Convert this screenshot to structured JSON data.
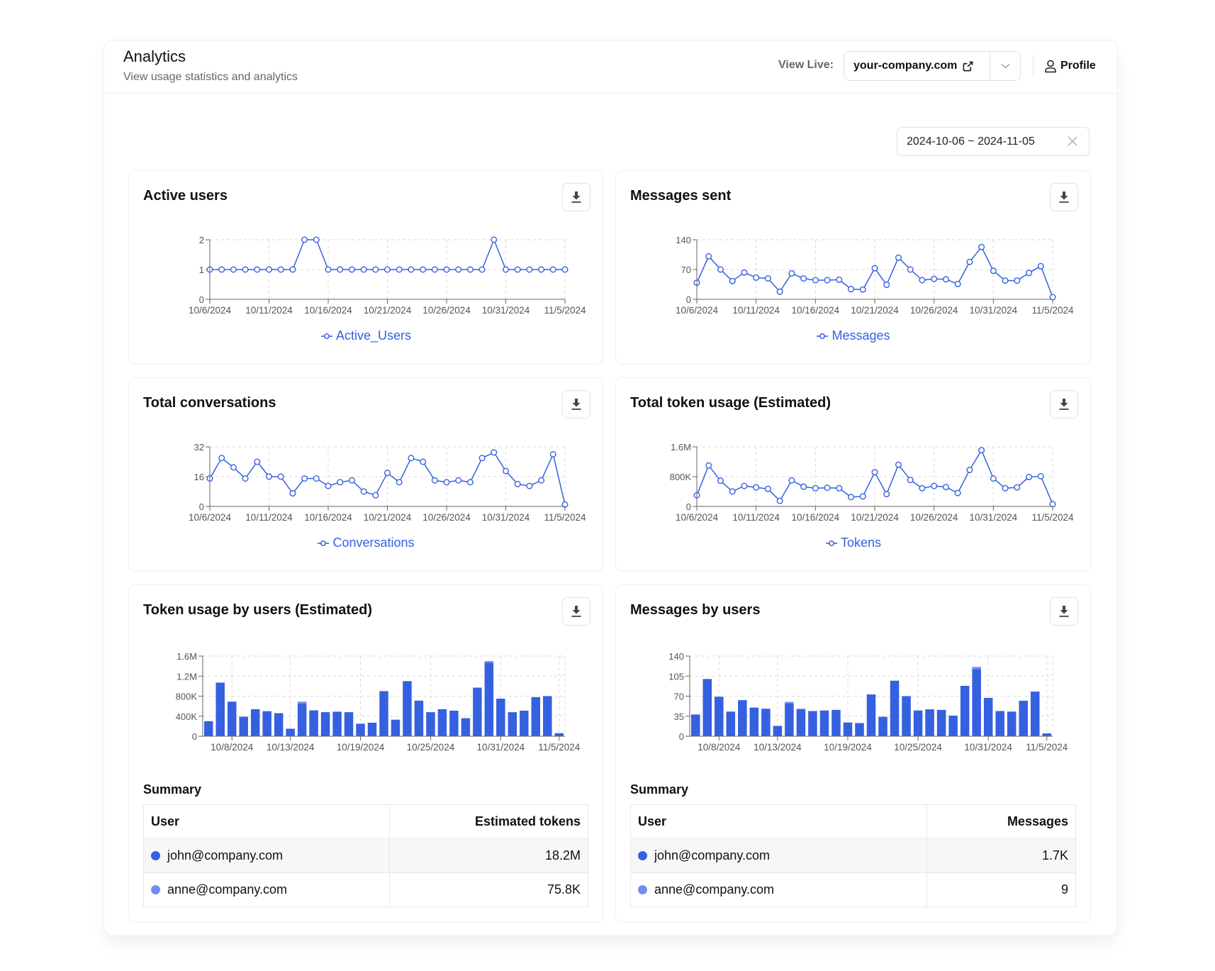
{
  "header": {
    "title": "Analytics",
    "subtitle": "View usage statistics and analytics",
    "view_live_label": "View Live:",
    "site": "your-company.com",
    "profile_label": "Profile"
  },
  "date_range": {
    "value": "2024-10-06 ~ 2024-11-05"
  },
  "colors": {
    "primary": "#3560e0",
    "secondary": "#6d8ff0",
    "grid": "#d9d9d9",
    "axis": "#666666"
  },
  "panels": {
    "active_users": {
      "title": "Active users",
      "legend": "Active_Users"
    },
    "messages_sent": {
      "title": "Messages sent",
      "legend": "Messages"
    },
    "total_conversations": {
      "title": "Total conversations",
      "legend": "Conversations"
    },
    "token_usage": {
      "title": "Total token usage (Estimated)",
      "legend": "Tokens"
    },
    "token_by_users": {
      "title": "Token usage by users (Estimated)",
      "summary_title": "Summary",
      "col_user": "User",
      "col_value": "Estimated tokens",
      "rows": [
        {
          "user": "john@company.com",
          "value": "18.2M",
          "color": "#3560e0"
        },
        {
          "user": "anne@company.com",
          "value": "75.8K",
          "color": "#6d8ff0"
        }
      ]
    },
    "messages_by_users": {
      "title": "Messages by users",
      "summary_title": "Summary",
      "col_user": "User",
      "col_value": "Messages",
      "rows": [
        {
          "user": "john@company.com",
          "value": "1.7K",
          "color": "#3560e0"
        },
        {
          "user": "anne@company.com",
          "value": "9",
          "color": "#6d8ff0"
        }
      ]
    }
  },
  "chart_data": [
    {
      "id": "active_users",
      "type": "line",
      "title": "Active users",
      "x_start": "2024-10-06",
      "x_ticks": [
        "10/6/2024",
        "10/11/2024",
        "10/16/2024",
        "10/21/2024",
        "10/26/2024",
        "10/31/2024",
        "11/5/2024"
      ],
      "y_ticks": [
        0,
        1,
        2
      ],
      "ylim": [
        0,
        2
      ],
      "legend": "Active_Users",
      "legend_position": "bottom",
      "grid": true,
      "values": [
        1,
        1,
        1,
        1,
        1,
        1,
        1,
        1,
        2,
        2,
        1,
        1,
        1,
        1,
        1,
        1,
        1,
        1,
        1,
        1,
        1,
        1,
        1,
        1,
        2,
        1,
        1,
        1,
        1,
        1,
        1
      ]
    },
    {
      "id": "messages_sent",
      "type": "line",
      "title": "Messages sent",
      "x_start": "2024-10-06",
      "x_ticks": [
        "10/6/2024",
        "10/11/2024",
        "10/16/2024",
        "10/21/2024",
        "10/26/2024",
        "10/31/2024",
        "11/5/2024"
      ],
      "y_ticks": [
        0,
        70,
        140
      ],
      "ylim": [
        0,
        140
      ],
      "legend": "Messages",
      "legend_position": "bottom",
      "grid": true,
      "values": [
        39,
        101,
        70,
        43,
        63,
        51,
        49,
        18,
        61,
        49,
        45,
        45,
        46,
        24,
        23,
        73,
        34,
        98,
        70,
        45,
        48,
        47,
        36,
        88,
        123,
        67,
        44,
        44,
        62,
        78,
        5
      ]
    },
    {
      "id": "total_conversations",
      "type": "line",
      "title": "Total conversations",
      "x_start": "2024-10-06",
      "x_ticks": [
        "10/6/2024",
        "10/11/2024",
        "10/16/2024",
        "10/21/2024",
        "10/26/2024",
        "10/31/2024",
        "11/5/2024"
      ],
      "y_ticks": [
        0,
        16,
        32
      ],
      "ylim": [
        0,
        32
      ],
      "legend": "Conversations",
      "legend_position": "bottom",
      "grid": true,
      "values": [
        15,
        26,
        21,
        15,
        24,
        16,
        16,
        7,
        15,
        15,
        11,
        13,
        14,
        8,
        6,
        18,
        13,
        26,
        24,
        14,
        13,
        14,
        13,
        26,
        29,
        19,
        12,
        11,
        14,
        28,
        1
      ]
    },
    {
      "id": "token_usage",
      "type": "line",
      "title": "Total token usage (Estimated)",
      "x_start": "2024-10-06",
      "x_ticks": [
        "10/6/2024",
        "10/11/2024",
        "10/16/2024",
        "10/21/2024",
        "10/26/2024",
        "10/31/2024",
        "11/5/2024"
      ],
      "y_ticks": [
        "0",
        "800K",
        "1.6M"
      ],
      "ylim": [
        0,
        1600000
      ],
      "legend": "Tokens",
      "legend_position": "bottom",
      "grid": true,
      "values": [
        300000,
        1100000,
        690000,
        400000,
        550000,
        510000,
        470000,
        150000,
        700000,
        530000,
        490000,
        500000,
        490000,
        250000,
        270000,
        920000,
        330000,
        1120000,
        710000,
        490000,
        550000,
        520000,
        360000,
        980000,
        1510000,
        750000,
        490000,
        510000,
        790000,
        810000,
        60000
      ]
    },
    {
      "id": "token_by_users",
      "type": "bar",
      "stacked": true,
      "title": "Token usage by users (Estimated)",
      "x_start": "2024-10-06",
      "x_ticks": [
        "10/8/2024",
        "10/13/2024",
        "10/19/2024",
        "10/25/2024",
        "10/31/2024",
        "11/5/2024"
      ],
      "y_ticks": [
        "0",
        "400K",
        "800K",
        "1.2M",
        "1.6M"
      ],
      "ylim": [
        0,
        1600000
      ],
      "grid": true,
      "series": [
        {
          "name": "john@company.com",
          "values": [
            300000,
            1070000,
            690000,
            390000,
            540000,
            500000,
            460000,
            150000,
            650000,
            510000,
            480000,
            490000,
            480000,
            250000,
            270000,
            900000,
            330000,
            1100000,
            710000,
            480000,
            540000,
            510000,
            360000,
            970000,
            1470000,
            750000,
            480000,
            510000,
            780000,
            800000,
            60000
          ]
        },
        {
          "name": "anne@company.com",
          "values": [
            0,
            0,
            0,
            0,
            0,
            0,
            0,
            0,
            40000,
            10000,
            0,
            0,
            0,
            0,
            0,
            0,
            0,
            0,
            0,
            0,
            0,
            0,
            0,
            0,
            30000,
            0,
            0,
            0,
            0,
            0,
            0
          ]
        }
      ]
    },
    {
      "id": "messages_by_users",
      "type": "bar",
      "stacked": true,
      "title": "Messages by users",
      "x_start": "2024-10-06",
      "x_ticks": [
        "10/8/2024",
        "10/13/2024",
        "10/19/2024",
        "10/25/2024",
        "10/31/2024",
        "11/5/2024"
      ],
      "y_ticks": [
        0,
        35,
        70,
        105,
        140
      ],
      "ylim": [
        0,
        140
      ],
      "grid": true,
      "series": [
        {
          "name": "john@company.com",
          "values": [
            38,
            100,
            69,
            43,
            63,
            50,
            48,
            18,
            57,
            47,
            44,
            45,
            46,
            24,
            23,
            73,
            34,
            97,
            70,
            45,
            47,
            46,
            36,
            88,
            117,
            67,
            44,
            43,
            62,
            78,
            5
          ]
        },
        {
          "name": "anne@company.com",
          "values": [
            0,
            0,
            0,
            0,
            0,
            0,
            0,
            0,
            3,
            1,
            0,
            0,
            0,
            0,
            0,
            0,
            0,
            0,
            0,
            0,
            0,
            0,
            0,
            0,
            4,
            0,
            0,
            0,
            0,
            0,
            0
          ]
        }
      ]
    }
  ]
}
